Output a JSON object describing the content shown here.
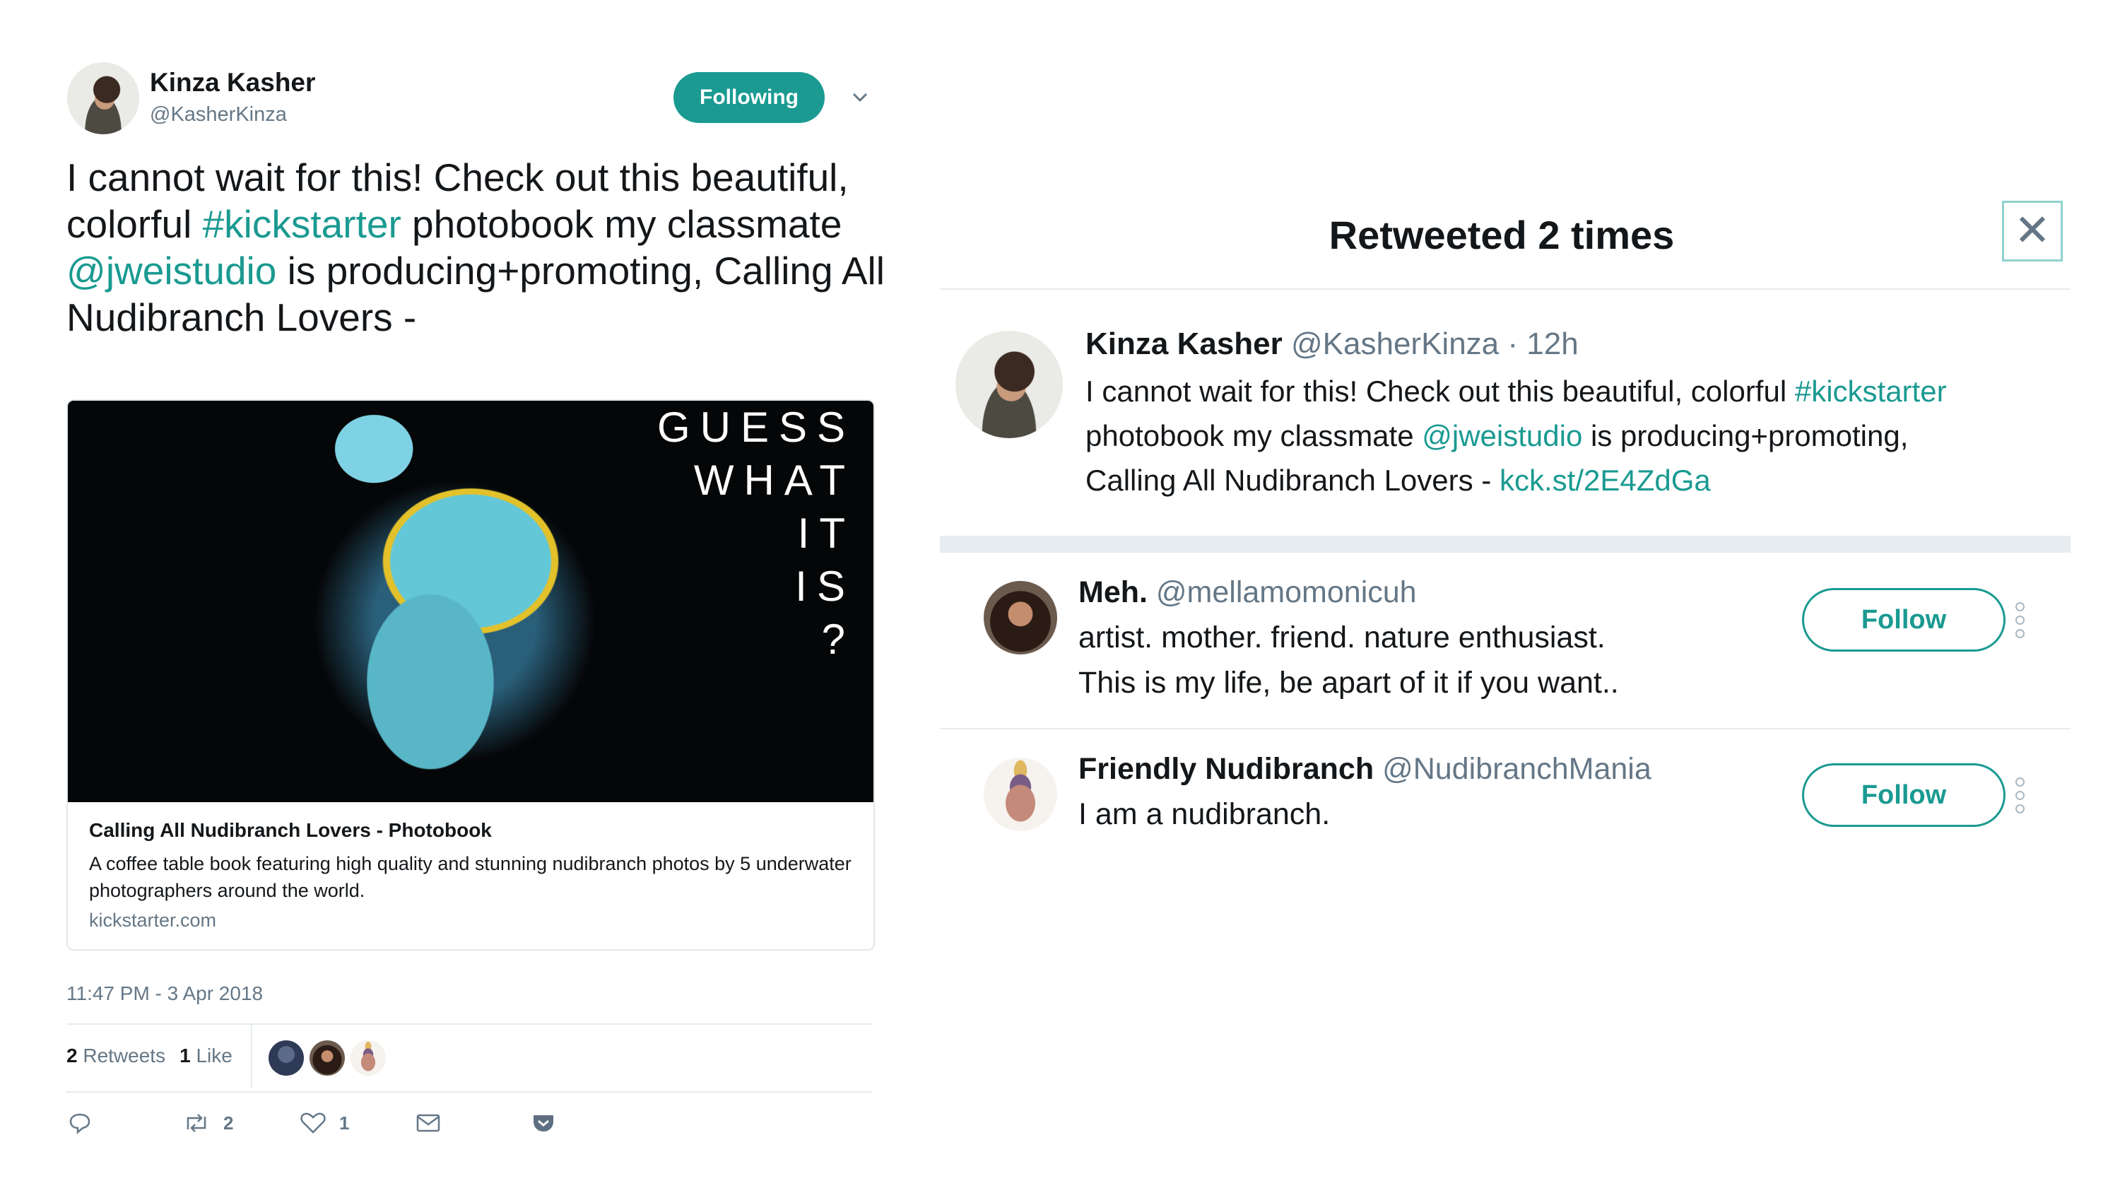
{
  "tweet": {
    "author_name": "Kinza Kasher",
    "author_handle": "@KasherKinza",
    "follow_state": "Following",
    "text_before_hashtag": "I cannot wait for this! Check out this beautiful, colorful ",
    "hashtag": "#kickstarter",
    "text_mid": " photobook my classmate ",
    "mention": "@jweistudio",
    "text_after": " is producing+promoting, Calling All Nudibranch Lovers -",
    "card": {
      "image_lines": [
        "GUESS",
        "WHAT",
        "IT",
        "IS",
        "?"
      ],
      "title": "Calling All Nudibranch Lovers - Photobook",
      "description": "A coffee table book featuring high quality and stunning nudibranch photos by 5 underwater photographers around the world.",
      "domain": "kickstarter.com"
    },
    "timestamp": "11:47 PM - 3 Apr 2018",
    "retweet_count": "2",
    "retweet_label": "Retweets",
    "like_count": "1",
    "like_label": "Like",
    "actions": {
      "retweets": "2",
      "likes": "1"
    }
  },
  "modal": {
    "title": "Retweeted 2 times",
    "close_glyph": "✕",
    "original": {
      "name": "Kinza Kasher",
      "handle": "@KasherKinza",
      "time": "· 12h",
      "line1_before": "I cannot wait for this! Check out this beautiful, colorful ",
      "hashtag": "#kickstarter",
      "line2_before": "photobook my classmate ",
      "mention": "@jweistudio",
      "line2_after": " is producing+promoting,",
      "line3_before": "Calling All Nudibranch Lovers - ",
      "short_link": "kck.st/2E4ZdGa"
    },
    "users": [
      {
        "name": "Meh.",
        "handle": "@mellamomonicuh",
        "bio_line1": "artist. mother. friend. nature enthusiast.",
        "bio_line2": "This is my life, be apart of it if you want..",
        "follow_label": "Follow"
      },
      {
        "name": "Friendly Nudibranch",
        "handle": "@NudibranchMania",
        "bio_line1": "I am a nudibranch.",
        "follow_label": "Follow"
      }
    ]
  },
  "colors": {
    "accent": "#1a9a91",
    "muted_text": "#657786",
    "divider": "#e6ecf0"
  }
}
